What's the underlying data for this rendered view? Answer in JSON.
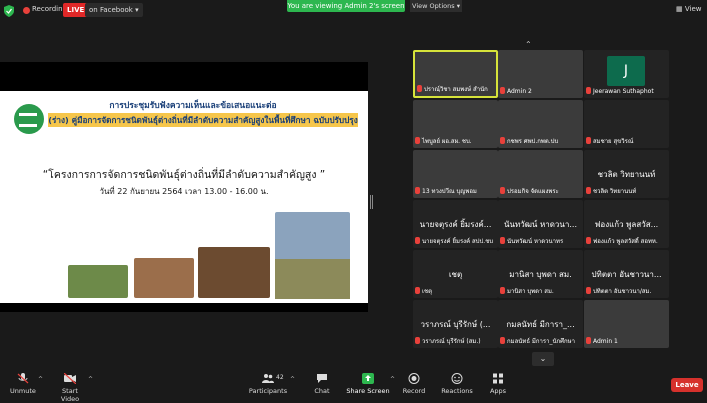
{
  "topbar": {
    "recording_label": "Recording",
    "live_label": "LIVE",
    "facebook_label": "on Facebook",
    "banner_text": "You are viewing Admin 2's screen",
    "view_options_label": "View Options",
    "view_label": "View"
  },
  "slide": {
    "line1": "การประชุมรับฟังความเห็นและข้อเสนอแนะต่อ",
    "line2": "(ร่าง) คู่มือการจัดการชนิดพันธุ์ต่างถิ่นที่มีลำดับความสำคัญสูงในพื้นที่ศึกษา ฉบับปรับปรุง",
    "line3": "“โครงการการจัดการชนิดพันธุ์ต่างถิ่นที่มีลำดับความสำคัญสูง ”",
    "line4": "วันที่ 22 กันยายน 2564 เวลา 13.00 - 16.00 น."
  },
  "gallery": {
    "tiles": [
      {
        "name": "ปราณฺ์วิชา สมพงษ์ สำนัก",
        "big": ""
      },
      {
        "name": "Admin 2",
        "big": ""
      },
      {
        "name": "Jeerawan Suthaphot",
        "big": "",
        "avatar": "J"
      },
      {
        "name": "ไพบูลย์ ผอ.สผ. ชบ.",
        "big": ""
      },
      {
        "name": "กชพร ศพป.กพต.ปบ",
        "big": ""
      },
      {
        "name": "สมชาย สุขวิรณ์",
        "big": ""
      },
      {
        "name": "13 ทวงปวีณ บุญพอม",
        "big": ""
      },
      {
        "name": "ปรอมกิจ จัดแผงพระ",
        "big": ""
      },
      {
        "name": "ชวลิต วิทยานนท์",
        "big": "ชวลิต วิทยานนท์"
      },
      {
        "name": "นายจตุรงค์ ยิ้มรงค์ สปป.ชบ",
        "big": "นายจตุรงค์ ยิ้มรงค์..."
      },
      {
        "name": "นันทวัฒน์ หาดวนาทร",
        "big": "นันทวัฒน์ หาดวนา..."
      },
      {
        "name": "ฟองแก้ว พูลสวัสดิ์ สอทห.",
        "big": "ฟองแก้ว พูลสวัส..."
      },
      {
        "name": "เชตุ",
        "big": "เชตุ"
      },
      {
        "name": "มานิสา บุพดา สม.",
        "big": "มานิสา บุพดา สม."
      },
      {
        "name": "ปทิตตา อันชาวนา/สม.",
        "big": "ปทิตตา อันชาวนา..."
      },
      {
        "name": "วราภรณ์ บุรีรักษ์ (สม.)",
        "big": "วราภรณ์ บุรีรักษ์ (..."
      },
      {
        "name": "กมลนัทธ์ มีการา_นักศึกษา",
        "big": "กมลนัทธ์ มีการา_..."
      },
      {
        "name": "Admin 1",
        "big": ""
      }
    ],
    "page_indicator": "1/2"
  },
  "toolbar": {
    "unmute": "Unmute",
    "start_video": "Start Video",
    "participants": "Participants",
    "participants_count": "42",
    "chat": "Chat",
    "share_screen": "Share Screen",
    "record": "Record",
    "reactions": "Reactions",
    "apps": "Apps",
    "leave": "Leave"
  }
}
